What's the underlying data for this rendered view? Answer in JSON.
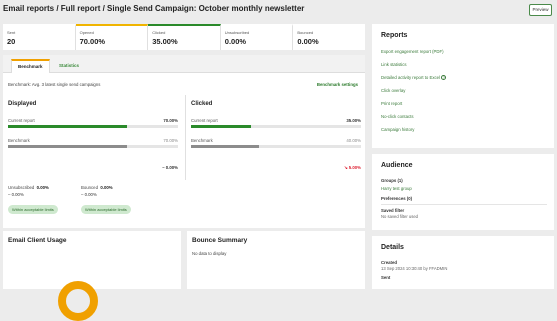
{
  "header": {
    "title": "Email reports / Full report / Single Send Campaign: October monthly newsletter",
    "preview_label": "Preview"
  },
  "stats": [
    {
      "label": "Sent",
      "value": "20",
      "accent": "plain"
    },
    {
      "label": "Opened",
      "value": "70.00%",
      "accent": "yellow"
    },
    {
      "label": "Clicked",
      "value": "35.00%",
      "accent": "green"
    },
    {
      "label": "Unsubscribed",
      "value": "0.00%",
      "accent": "plain"
    },
    {
      "label": "Bounced",
      "value": "0.00%",
      "accent": "plain"
    }
  ],
  "benchmark": {
    "tabs": [
      "Benchmark",
      "Statistics"
    ],
    "subtitle": "Benchmark: Avg. 3 latest single send campaigns",
    "settings_label": "Benchmark settings",
    "displayed": {
      "title": "Displayed",
      "current_label": "Current report",
      "current_value": "70.00%",
      "current_fraction": 0.7,
      "benchmark_label": "Benchmark",
      "benchmark_value": "70.00%",
      "benchmark_fraction": 0.7,
      "diff": "– 0.00%"
    },
    "clicked": {
      "title": "Clicked",
      "current_label": "Current report",
      "current_value": "35.00%",
      "current_fraction": 0.35,
      "benchmark_label": "Benchmark",
      "benchmark_value": "40.00%",
      "benchmark_fraction": 0.4,
      "diff": "↘ 5.00%"
    },
    "unsubscribed": {
      "label": "Unsubscribed",
      "value": "0.00%",
      "diff": "– 0.00%",
      "status": "Within acceptable limits"
    },
    "bounced": {
      "label": "Bounced",
      "value": "0.00%",
      "diff": "– 0.00%",
      "status": "Within acceptable limits"
    }
  },
  "email_client": {
    "title": "Email Client Usage"
  },
  "bounce_summary": {
    "title": "Bounce Summary",
    "empty": "No data to display"
  },
  "reports": {
    "title": "Reports",
    "links": [
      "Export engagement report (PDF)",
      "Link statistics",
      "Detailed activity report to Excel",
      "Click overlay",
      "Print report",
      "No-click contacts",
      "Campaign history"
    ]
  },
  "audience": {
    "title": "Audience",
    "groups_label": "Groups (1)",
    "group_name": "Harry test group",
    "preferences_label": "Preferences (0)",
    "saved_filter_label": "Saved filter",
    "saved_filter_value": "No saved filter used"
  },
  "details": {
    "title": "Details",
    "created_label": "Created",
    "created_value": "13 Sep 2024 10:30:40 by FFADMIN",
    "sent_label": "Sent"
  },
  "colors": {
    "accent_green": "#2a8a2a",
    "accent_yellow": "#f0b400",
    "bad_red": "#dd2233"
  }
}
